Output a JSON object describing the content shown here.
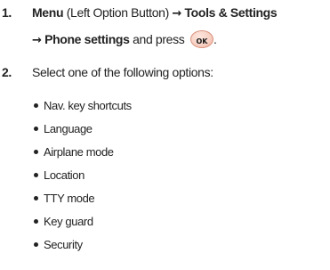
{
  "step1": {
    "number": "1.",
    "menu": "Menu",
    "menu_note": " (Left Option Button) ",
    "arrow": "→",
    "tools": "Tools & Settings",
    "phone_settings": "Phone settings",
    "press_text": " and press ",
    "ok_label": "OK",
    "period": "."
  },
  "step2": {
    "number": "2.",
    "text": "Select one of the following options:"
  },
  "options": [
    "Nav. key shortcuts",
    "Language",
    "Airplane mode",
    "Location",
    "TTY mode",
    "Key guard",
    "Security"
  ]
}
